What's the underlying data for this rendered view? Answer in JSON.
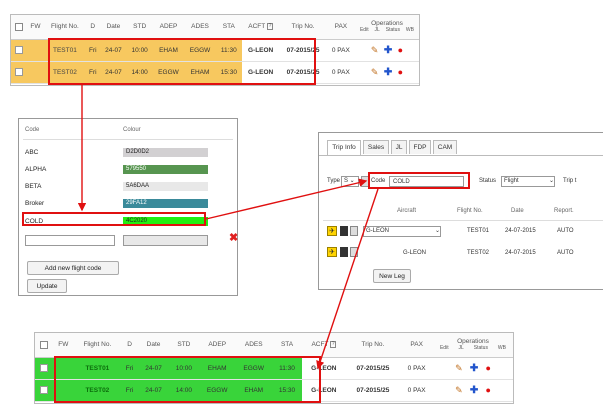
{
  "flight_table": {
    "headers": [
      "FW",
      "Flight No.",
      "D",
      "Date",
      "STD",
      "ADEP",
      "ADES",
      "STA",
      "ACFT",
      "Trip No.",
      "PAX"
    ],
    "operations_label": "Operations",
    "operations_sub": [
      "Edit",
      "JL",
      "Status",
      "WB"
    ],
    "rows": [
      {
        "flight": "TEST01",
        "d": "Fri",
        "date": "24-07",
        "std": "10:00",
        "adep": "EHAM",
        "ades": "EGGW",
        "sta": "11:30",
        "acft": "G-LEON",
        "trip": "07-2015/25",
        "pax": "0 PAX"
      },
      {
        "flight": "TEST02",
        "d": "Fri",
        "date": "24-07",
        "std": "14:00",
        "adep": "EGGW",
        "ades": "EHAM",
        "sta": "15:30",
        "acft": "G-LEON",
        "trip": "07-2015/25",
        "pax": "0 PAX"
      }
    ]
  },
  "code_panel": {
    "col_code": "Code",
    "col_colour": "Colour",
    "codes": [
      {
        "code": "ABC",
        "colour": "D2D0D2",
        "swatch": "#d2d0d2"
      },
      {
        "code": "ALPHA",
        "colour": "579550",
        "swatch": "#579550"
      },
      {
        "code": "BETA",
        "colour": "5A6DAA",
        "swatch": "#e8e8e8"
      },
      {
        "code": "Broker",
        "colour": "29FA12",
        "swatch": "#3a8a9a"
      },
      {
        "code": "COLD",
        "colour": "4C2020",
        "swatch": "#22ee11"
      }
    ],
    "add_button": "Add new flight code",
    "update_button": "Update",
    "delete_symbol": "✖"
  },
  "trip_panel": {
    "tabs": [
      "Trip Info",
      "Sales",
      "JL",
      "FDP",
      "CAM"
    ],
    "type_label": "Type",
    "type_value": "S",
    "code_label": "Code",
    "code_value": "COLD",
    "status_label": "Status",
    "status_value": "Flight",
    "trip_label": "Trip t",
    "col_aircraft": "Aircraft",
    "col_flight": "Flight No.",
    "col_date": "Date",
    "col_report": "Report.",
    "rows": [
      {
        "aircraft": "G-LEON",
        "flight": "TEST01",
        "date": "24-07-2015",
        "report": "AUTO"
      },
      {
        "aircraft": "G-LEON",
        "flight": "TEST02",
        "date": "24-07-2015",
        "report": "AUTO"
      }
    ],
    "new_leg_button": "New Leg"
  }
}
